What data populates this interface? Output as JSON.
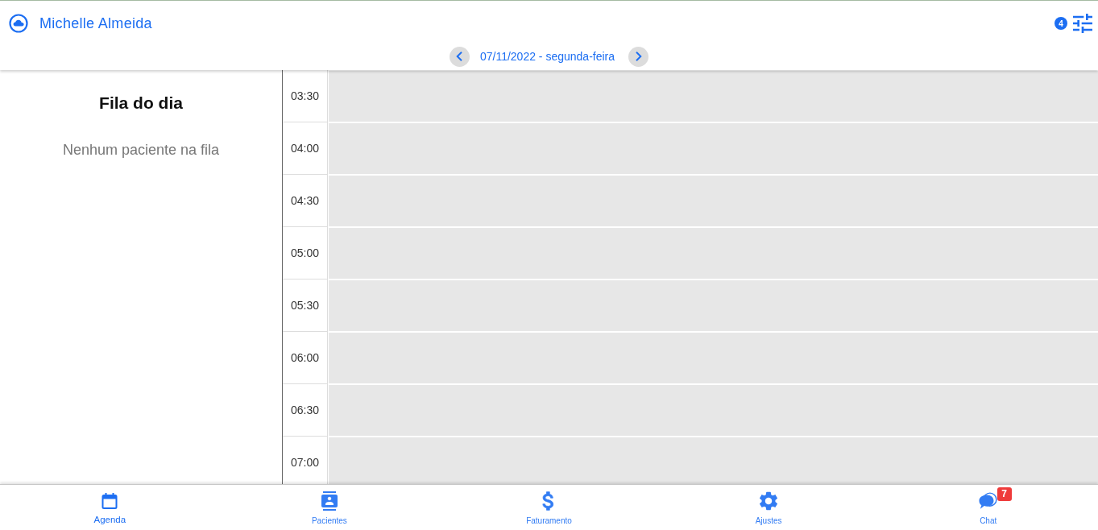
{
  "header": {
    "user_name": "Michelle Almeida",
    "filter_count": "4"
  },
  "date_nav": {
    "date": "07/11/2022 - segunda-feira"
  },
  "queue": {
    "title": "Fila do dia",
    "empty_message": "Nenhum paciente na fila"
  },
  "schedule": {
    "slots": [
      {
        "time": "03:30"
      },
      {
        "time": "04:00"
      },
      {
        "time": "04:30"
      },
      {
        "time": "05:00"
      },
      {
        "time": "05:30"
      },
      {
        "time": "06:00"
      },
      {
        "time": "06:30"
      },
      {
        "time": "07:00"
      }
    ]
  },
  "bottom_nav": {
    "tabs": [
      {
        "kind": "calendar",
        "label": "Agenda",
        "selected": true
      },
      {
        "kind": "patients",
        "label": "Pacientes",
        "selected": false
      },
      {
        "kind": "billing",
        "label": "Faturamento",
        "selected": false
      },
      {
        "kind": "settings",
        "label": "Ajustes",
        "selected": false
      },
      {
        "kind": "chat",
        "label": "Chat",
        "selected": false,
        "badge": "7"
      }
    ]
  }
}
